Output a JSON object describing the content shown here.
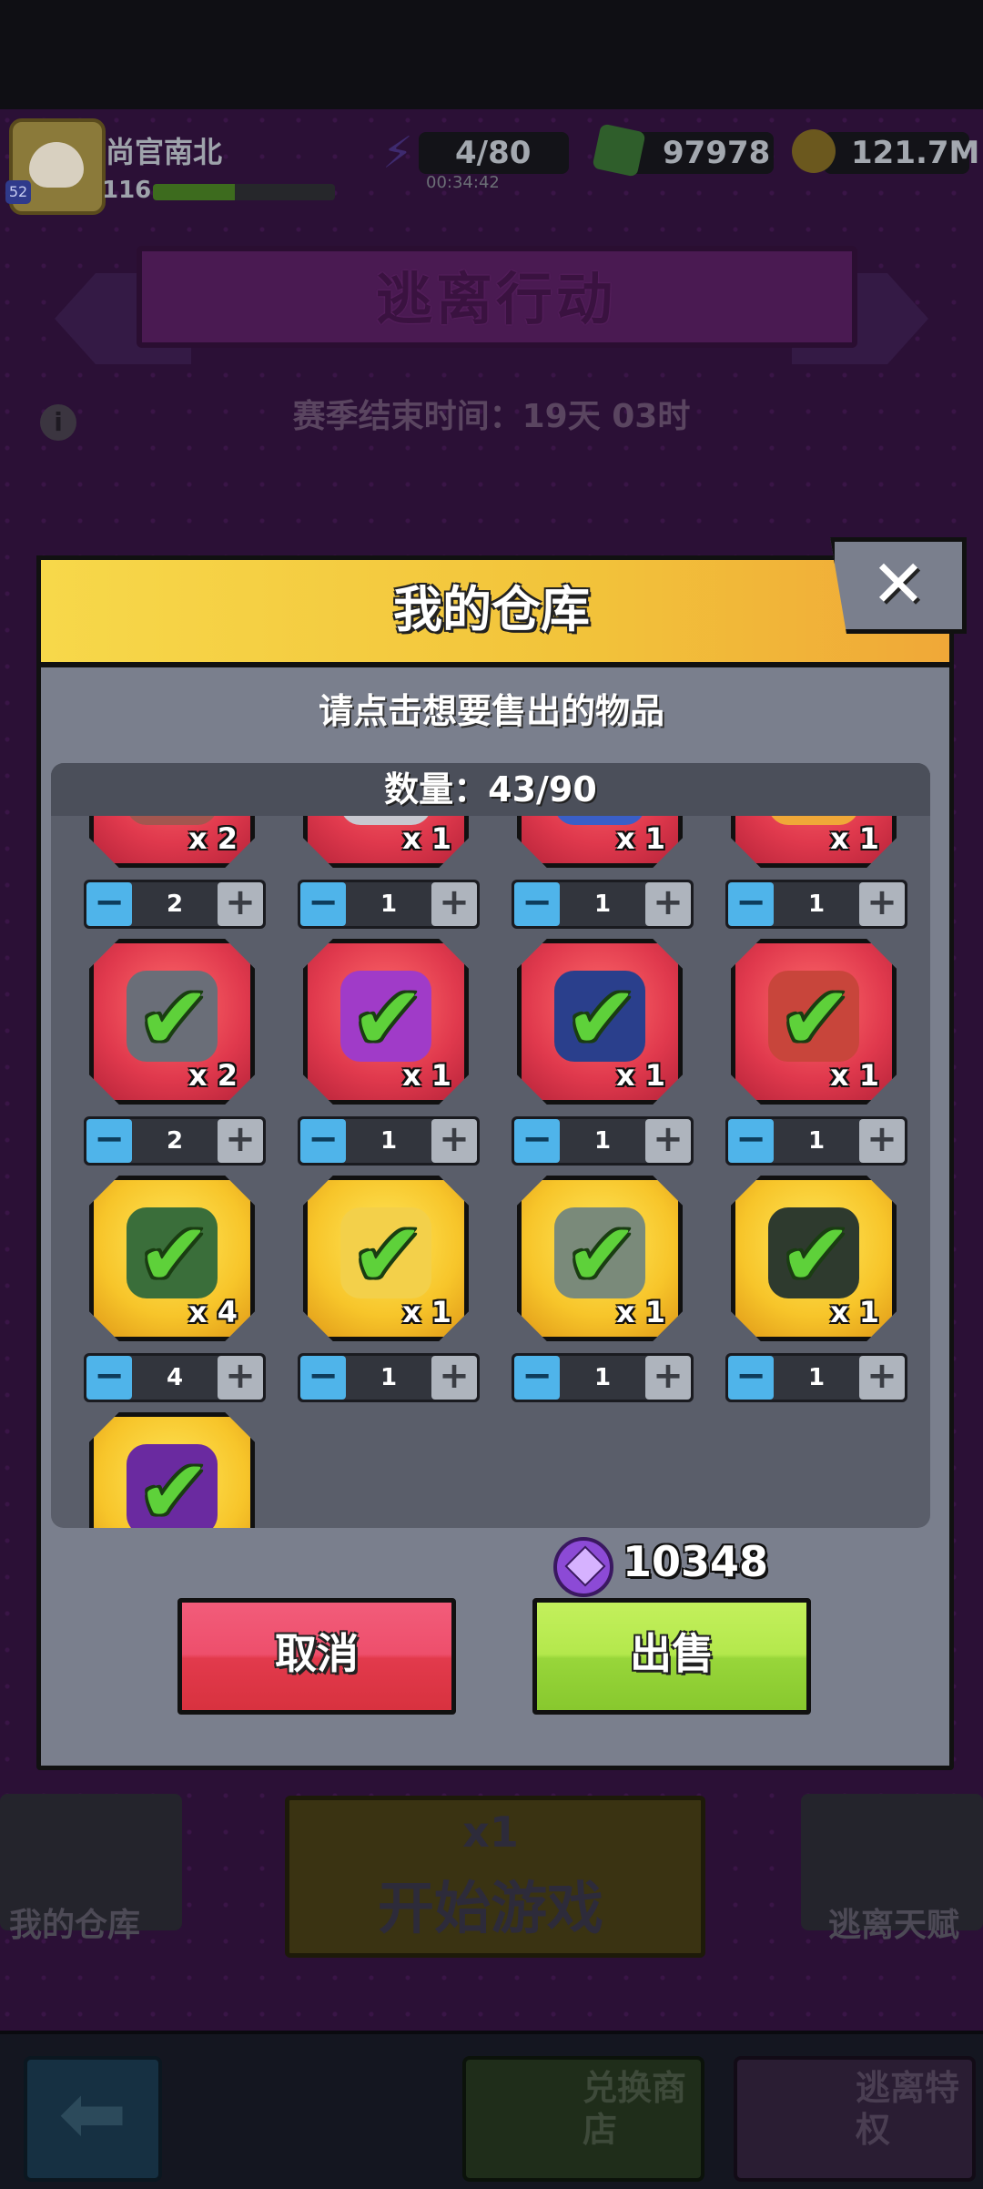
{
  "player": {
    "name": "尚官南北",
    "level": "116",
    "badge_level": "52",
    "xp_fraction": 0.45
  },
  "resources": {
    "energy": "4/80",
    "energy_timer": "00:34:42",
    "gems": "97978",
    "coins": "121.7M"
  },
  "mode": {
    "title": "逃离行动",
    "season_end": "赛季结束时间：19天 03时"
  },
  "background_buttons": {
    "start": {
      "cost": "x1",
      "label": "开始游戏"
    },
    "warehouse": "我的仓库",
    "talent": "逃离天赋",
    "shop": "兑换商店",
    "privilege": "逃离特权"
  },
  "dialog": {
    "title": "我的仓库",
    "instruction": "请点击想要售出的物品",
    "count": "数量：43/90",
    "close_label": "✕",
    "total_gems": "10348",
    "cancel_label": "取消",
    "sell_label": "出售"
  },
  "items": [
    {
      "rarity": "red",
      "qty_badge": "x 2",
      "stepper": "2",
      "icon": "book-icon",
      "selected": true
    },
    {
      "rarity": "red",
      "qty_badge": "x 1",
      "stepper": "1",
      "icon": "drone-icon",
      "selected": true
    },
    {
      "rarity": "red",
      "qty_badge": "x 1",
      "stepper": "1",
      "icon": "chip-icon",
      "selected": true
    },
    {
      "rarity": "red",
      "qty_badge": "x 1",
      "stepper": "1",
      "icon": "sword-icon",
      "selected": true
    },
    {
      "rarity": "red",
      "qty_badge": "x 2",
      "stepper": "2",
      "icon": "dice-icon",
      "selected": true
    },
    {
      "rarity": "red",
      "qty_badge": "x 1",
      "stepper": "1",
      "icon": "flower-icon",
      "selected": true
    },
    {
      "rarity": "red",
      "qty_badge": "x 1",
      "stepper": "1",
      "icon": "helmet-icon",
      "selected": true
    },
    {
      "rarity": "red",
      "qty_badge": "x 1",
      "stepper": "1",
      "icon": "potion-icon",
      "selected": true
    },
    {
      "rarity": "yellow",
      "qty_badge": "x 4",
      "stepper": "4",
      "icon": "circuit-board-icon",
      "selected": true
    },
    {
      "rarity": "yellow",
      "qty_badge": "x 1",
      "stepper": "1",
      "icon": "compass-icon",
      "selected": true
    },
    {
      "rarity": "yellow",
      "qty_badge": "x 1",
      "stepper": "1",
      "icon": "canister-icon",
      "selected": true
    },
    {
      "rarity": "yellow",
      "qty_badge": "x 1",
      "stepper": "1",
      "icon": "ring-icon",
      "selected": true
    },
    {
      "rarity": "yellow",
      "qty_badge": "",
      "stepper": "",
      "icon": "crystal-icon",
      "selected": true
    }
  ],
  "colors": {
    "red_tile": "#e0394d",
    "yellow_tile": "#f7c52a",
    "check": "#5ed13a",
    "stepper_minus": "#4fb4ea",
    "stepper_plus": "#aeb4bd",
    "cancel": "#e23a4c",
    "sell": "#98d63a",
    "header": "#f2c33a"
  }
}
